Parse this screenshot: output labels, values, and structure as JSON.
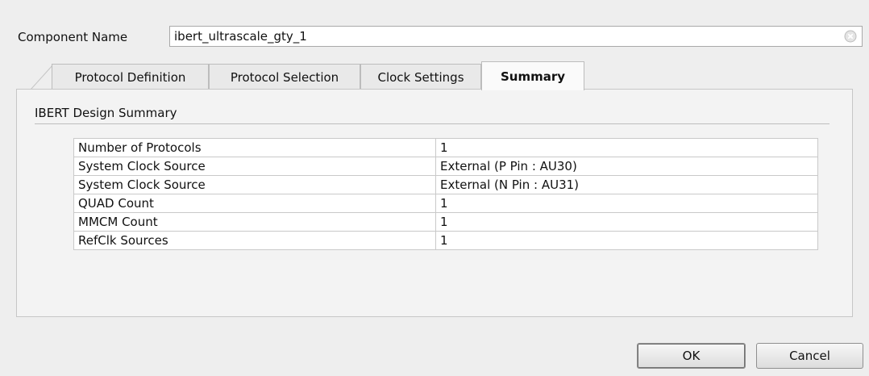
{
  "component": {
    "label": "Component Name",
    "value": "ibert_ultrascale_gty_1"
  },
  "tabs": [
    {
      "label": "Protocol Definition",
      "active": false
    },
    {
      "label": "Protocol Selection",
      "active": false
    },
    {
      "label": "Clock Settings",
      "active": false
    },
    {
      "label": "Summary",
      "active": true
    }
  ],
  "summary": {
    "title": "IBERT Design Summary",
    "rows": [
      {
        "key": "Number of Protocols",
        "value": "1"
      },
      {
        "key": "System Clock Source",
        "value": "External (P Pin : AU30)"
      },
      {
        "key": "System Clock Source",
        "value": "External (N Pin : AU31)"
      },
      {
        "key": "QUAD Count",
        "value": "1"
      },
      {
        "key": "MMCM Count",
        "value": "1"
      },
      {
        "key": "RefClk Sources",
        "value": "1"
      }
    ]
  },
  "buttons": {
    "ok": "OK",
    "cancel": "Cancel"
  },
  "icons": {
    "clear": "clear-field-icon"
  }
}
